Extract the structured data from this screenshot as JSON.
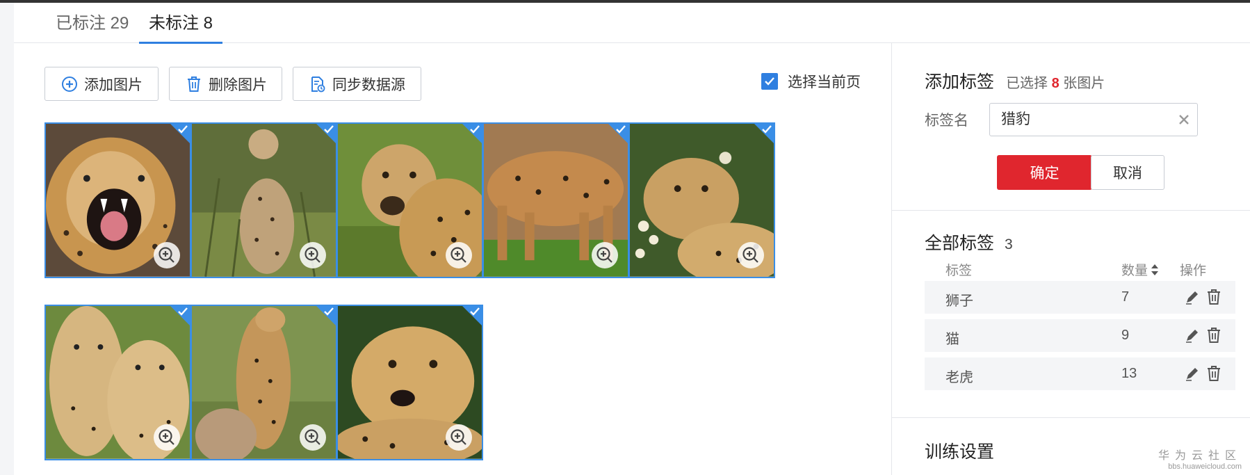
{
  "tabs": {
    "labeled": "已标注 29",
    "unlabeled": "未标注 8"
  },
  "toolbar": {
    "add_label": "添加图片",
    "delete_label": "删除图片",
    "sync_label": "同步数据源",
    "select_page_label": "选择当前页",
    "select_page_checked": true
  },
  "images": [
    {
      "name": "cheetah-snarl",
      "selected": true
    },
    {
      "name": "cheetah-standing-grass",
      "selected": true
    },
    {
      "name": "cheetah-portrait",
      "selected": true
    },
    {
      "name": "cheetah-walking",
      "selected": true
    },
    {
      "name": "cheetah-lying-flowers",
      "selected": true
    },
    {
      "name": "cheetah-pair",
      "selected": true
    },
    {
      "name": "cheetah-with-cub",
      "selected": true
    },
    {
      "name": "cheetah-closeup",
      "selected": true
    }
  ],
  "add_tag": {
    "title": "添加标签",
    "selected_prefix": "已选择",
    "selected_count": "8",
    "selected_suffix": "张图片",
    "field_label": "标签名",
    "field_value": "猎豹",
    "confirm_label": "确定",
    "cancel_label": "取消"
  },
  "all_tags": {
    "title": "全部标签",
    "count": "3",
    "col_tag": "标签",
    "col_count": "数量",
    "col_ops": "操作",
    "rows": [
      {
        "name": "狮子",
        "count": "7"
      },
      {
        "name": "猫",
        "count": "9"
      },
      {
        "name": "老虎",
        "count": "13"
      }
    ]
  },
  "training": {
    "title": "训练设置"
  },
  "watermark": {
    "line1": "华为云社区",
    "line2": "bbs.huaweicloud.com"
  },
  "colors": {
    "accent": "#2f7fe0",
    "danger": "#e0262e"
  },
  "icons": {
    "add": "plus-circle-icon",
    "delete": "trash-icon",
    "sync": "sync-document-icon",
    "zoom": "zoom-in-icon",
    "check": "check-icon",
    "clear": "close-icon",
    "edit": "pencil-icon",
    "sort": "sort-icon"
  }
}
